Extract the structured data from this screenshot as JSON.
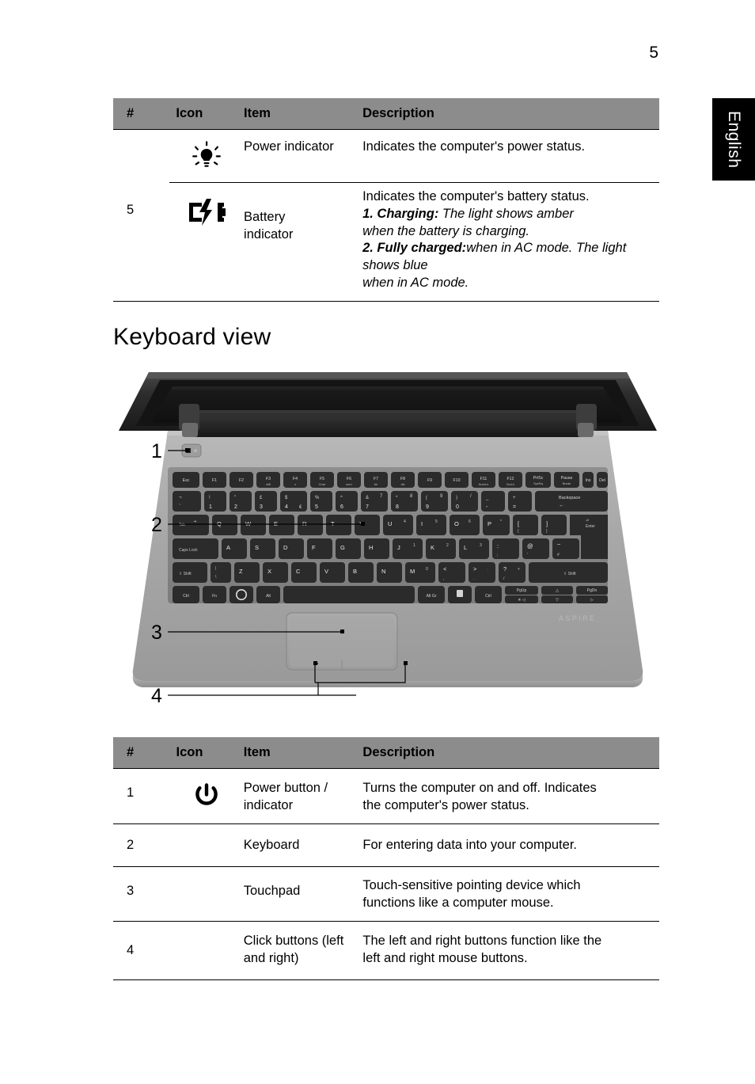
{
  "page": {
    "number": "5",
    "language_tab": "English"
  },
  "table_top": {
    "headers": {
      "num": "#",
      "icon": "Icon",
      "item": "Item",
      "description": "Description"
    },
    "group_number": "5",
    "rows": [
      {
        "icon_name": "power-indicator-icon",
        "item": "Power indicator",
        "description_lines": [
          {
            "text": "Indicates the computer's power status.",
            "style": "normal"
          }
        ]
      },
      {
        "icon_name": "battery-indicator-icon",
        "item_line1": "Battery",
        "item_line2": "indicator",
        "description_lines": [
          {
            "text": "Indicates the computer's battery status.",
            "style": "normal"
          },
          {
            "label": "1. Charging:",
            "text": " The light shows amber",
            "style": "bold-italic-lead"
          },
          {
            "text": "when the battery is charging.",
            "style": "italic"
          },
          {
            "label": "2. Fully charged:",
            "text": " The light shows blue",
            "style": "bold-italic-lead"
          },
          {
            "text": "when in AC mode.",
            "style": "italic"
          }
        ]
      }
    ]
  },
  "heading": "Keyboard view",
  "illustration": {
    "name": "acer-aspire-keyboard-view-diagram",
    "brand_logo": "ASPIRE",
    "callouts": [
      {
        "number": "1",
        "target": "power-button-indicator"
      },
      {
        "number": "2",
        "target": "keyboard"
      },
      {
        "number": "3",
        "target": "touchpad"
      },
      {
        "number": "4",
        "target": "click-buttons"
      }
    ],
    "keyboard_rows": [
      [
        "Esc",
        "F1",
        "F2",
        "F3",
        "F4",
        "F5",
        "F6",
        "F7",
        "F8",
        "F9",
        "F10",
        "F11",
        "F12",
        "PrtSc SysRq",
        "Pause Break",
        "Ins",
        "Del"
      ],
      [
        "¬ `",
        "! 1",
        "\" 2",
        "£ 3",
        "$ 4",
        "% 5",
        "^ 6",
        "& 7",
        "* 8",
        "( 9",
        ") 0",
        "_ -",
        "+ =",
        "Backspace"
      ],
      [
        "Tab",
        "Q",
        "W",
        "E",
        "R",
        "T",
        "Y",
        "U",
        "I",
        "O",
        "P",
        "{ [",
        "} ]",
        "Enter"
      ],
      [
        "Caps Lock",
        "A",
        "S",
        "D",
        "F",
        "G",
        "H",
        "J",
        "K",
        "L",
        ": ;",
        "@ '",
        "~ #"
      ],
      [
        "Shift",
        "| \\",
        "Z",
        "X",
        "C",
        "V",
        "B",
        "N",
        "M",
        "< ,",
        "> .",
        "? /",
        "Shift"
      ],
      [
        "Ctrl",
        "Fn",
        "Win",
        "Alt",
        "Space",
        "Alt Gr",
        "Menu",
        "Ctrl",
        "PgUp Home",
        "Up",
        "PgDn End"
      ]
    ]
  },
  "table_bottom": {
    "headers": {
      "num": "#",
      "icon": "Icon",
      "item": "Item",
      "description": "Description"
    },
    "rows": [
      {
        "num": "1",
        "icon_name": "power-button-icon",
        "item_line1": "Power button /",
        "item_line2": "indicator",
        "desc_line1": "Turns the computer on and off. Indicates",
        "desc_line2": "the computer's power status."
      },
      {
        "num": "2",
        "icon_name": "",
        "item_line1": "Keyboard",
        "item_line2": "",
        "desc_line1": "For entering data into your computer.",
        "desc_line2": ""
      },
      {
        "num": "3",
        "icon_name": "",
        "item_line1": "Touchpad",
        "item_line2": "",
        "desc_line1": "Touch-sensitive pointing device which",
        "desc_line2": "functions like a computer mouse."
      },
      {
        "num": "4",
        "icon_name": "",
        "item_line1": "Click buttons (left",
        "item_line2": "and right)",
        "desc_line1": "The left and right buttons function like the",
        "desc_line2": "left and right mouse buttons."
      }
    ]
  },
  "colors": {
    "header_bg": "#8c8c8c",
    "rule": "#000000",
    "tab_bg": "#000000",
    "tab_text": "#ffffff"
  }
}
